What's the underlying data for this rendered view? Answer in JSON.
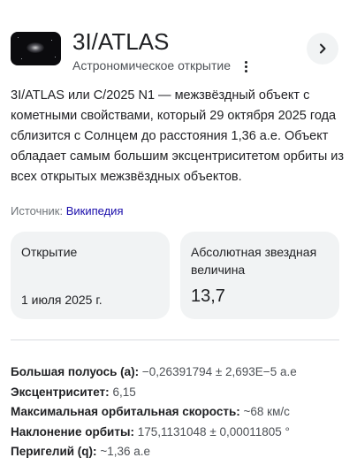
{
  "header": {
    "title": "3I/ATLAS",
    "subtitle": "Астрономическое открытие"
  },
  "description": "3I/ATLAS или C/2025 N1 — межзвёздный объект с кометными свойствами, который 29 октября 2025 года сблизится с Солнцем до расстояния 1,36 а.е. Объект обладает самым большим эксцентриситетом орбиты из всех открытых межзвёздных объектов.",
  "source": {
    "label": "Источник:",
    "link": "Википедия"
  },
  "cards": [
    {
      "label": "Открытие",
      "value": "1 июля 2025 г."
    },
    {
      "label": "Абсолютная звездная величина",
      "value": "13,7"
    }
  ],
  "facts": [
    {
      "label": "Большая полуось (a):",
      "value": "−0,26391794 ± 2,693E−5 а.е"
    },
    {
      "label": "Эксцентриситет:",
      "value": "6,15"
    },
    {
      "label": "Максимальная орбитальная скорость:",
      "value": "~68 км/с"
    },
    {
      "label": "Наклонение орбиты:",
      "value": "175,1131048 ± 0,00011805 °"
    },
    {
      "label": "Перигелий (q):",
      "value": "~1,36 а.е"
    }
  ],
  "colors": {
    "link": "#1a0dab",
    "card_bg": "#f1f3f4",
    "divider": "#dadce0",
    "muted_text": "#70757a"
  },
  "icons": {
    "thumbnail": "comet-image",
    "menu": "more-vert-icon",
    "next": "chevron-right-icon"
  }
}
